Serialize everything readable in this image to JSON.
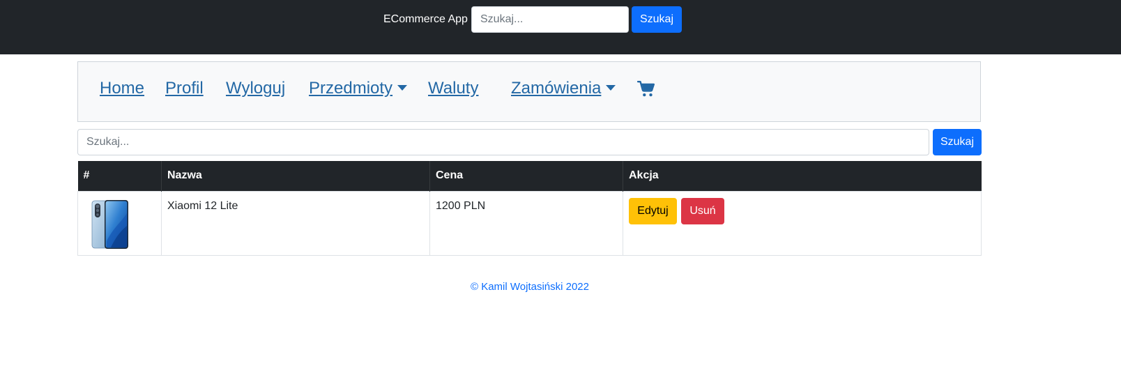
{
  "topbar": {
    "brand": "ECommerce App",
    "search_placeholder": "Szukaj...",
    "search_button": "Szukaj",
    "background_color": "#212529"
  },
  "nav": {
    "items": [
      {
        "label": "Home"
      },
      {
        "label": "Profil"
      },
      {
        "label": "Wyloguj"
      },
      {
        "label": "Przedmioty",
        "dropdown": true
      },
      {
        "label": "Waluty"
      },
      {
        "label": "Zamówienia",
        "dropdown": true
      }
    ],
    "cart_icon": "shopping-cart-icon",
    "link_color": "#2368a5"
  },
  "search": {
    "placeholder": "Szukaj...",
    "button": "Szukaj"
  },
  "table": {
    "headers": [
      "#",
      "Nazwa",
      "Cena",
      "Akcja"
    ],
    "rows": [
      {
        "image": "smartphone-image",
        "name": "Xiaomi 12 Lite",
        "price": "1200 PLN",
        "edit_label": "Edytuj",
        "delete_label": "Usuń"
      }
    ]
  },
  "footer": {
    "text": "© Kamil Wojtasiński 2022"
  },
  "colors": {
    "primary": "#0d6efd",
    "warning": "#ffc107",
    "danger": "#dc3545"
  }
}
